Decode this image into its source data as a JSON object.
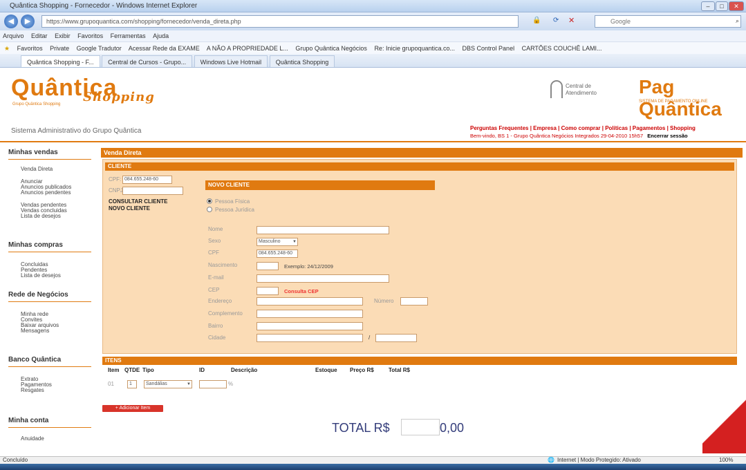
{
  "window": {
    "title": "Quântica Shopping - Fornecedor - Windows Internet Explorer"
  },
  "address": {
    "url": "https://www.grupoquantica.com/shopping/fornecedor/venda_direta.php",
    "search": "Google"
  },
  "menu": [
    "Arquivo",
    "Editar",
    "Exibir",
    "Favoritos",
    "Ferramentas",
    "Ajuda"
  ],
  "favorites": [
    "Favoritos",
    "Private",
    "Google Tradutor",
    "Acessar Rede da EXAME",
    "A NÃO A PROPRIEDADE L...",
    "Grupo Quântica Negócios",
    "Re: Inicie grupoquantica.co...",
    "DBS Control Panel",
    "CARTÕES COUCHÊ LAMI..."
  ],
  "tabs": [
    "Quântica Shopping - F...",
    "Central de Cursos - Grupo...",
    "Windows Live Hotmail",
    "Quântica Shopping"
  ],
  "header": {
    "logo": "Quântica",
    "logo_script": "Shopping",
    "logo_sub": "Grupo Quântica Shopping",
    "central_line1": "Central de",
    "central_line2": "Atendimento",
    "pag_logo": "Pag Quântica",
    "pag_sub": "SISTEMA DE PAGAMENTO ONLINE",
    "system_title": "Sistema Administrativo do Grupo Quântica",
    "top_links": "Perguntas Frequentes | Empresa | Como comprar | Políticas | Pagamentos | Shopping",
    "user_line": "Bem-vindo, BS 1 - Grupo Quântica Negócios Integrados 29-04-2010 15h57",
    "logout": "Encerrar sessão"
  },
  "sidebar": {
    "minhas_vendas": {
      "title": "Minhas vendas",
      "links": [
        "Venda Direta",
        "Anunciar",
        "Anuncios publicados",
        "Anuncios pendentes",
        "Vendas pendentes",
        "Vendas concluidas",
        "Lista de desejos"
      ]
    },
    "minhas_compras": {
      "title": "Minhas compras",
      "links": [
        "Concluidas",
        "Pendentes",
        "Lista de desejos"
      ]
    },
    "rede": {
      "title": "Rede de Negócios",
      "links": [
        "Minha rede",
        "Convites",
        "Baixar arquivos",
        "Mensagens"
      ]
    },
    "banco": {
      "title": "Banco Quântica",
      "links": [
        "Extrato",
        "Pagamentos",
        "Resgates"
      ]
    },
    "conta": {
      "title": "Minha conta",
      "links": [
        "Anuidade"
      ]
    }
  },
  "main": {
    "venda_direta": "Venda Direta",
    "cliente_header": "CLIENTE",
    "cpf_label": "CPF:",
    "cpf_value": "084.655.248-60",
    "cnpj_label": "CNPJ:",
    "consultar": "CONSULTAR CLIENTE",
    "novo_cliente": "NOVO CLIENTE",
    "novo_header": "NOVO CLIENTE",
    "pessoa_fisica": "Pessoa Física",
    "pessoa_juridica": "Pessoa Jurídica",
    "fields": {
      "nome": "Nome",
      "sexo": "Sexo",
      "sexo_value": "Masculino",
      "cpf": "CPF",
      "cpf_value": "084.655.248-60",
      "nascimento": "Nascimento",
      "nascimento_example": "Exemplo: 24/12/2009",
      "email": "E-mail",
      "cep": "CEP",
      "consulta_cep": "Consulta CEP",
      "endereco": "Endereço",
      "numero": "Número",
      "complemento": "Complemento",
      "bairro": "Bairro",
      "cidade": "Cidade",
      "slash": "/"
    },
    "itens_header": "ITENS",
    "itens_cols": [
      "Item",
      "QTDE",
      "Tipo",
      "ID",
      "Descrição",
      "Estoque",
      "Preço R$",
      "Total R$"
    ],
    "itens_row": {
      "item": "01",
      "qtde": "1",
      "tipo": "Sandálias",
      "pct": "%"
    },
    "add_item": "+ Adicionar Item",
    "total_label": "TOTAL R$",
    "total_value": "0,00"
  },
  "status": {
    "left": "Concluído",
    "zone": "Internet | Modo Protegido: Ativado",
    "zoom": "100%"
  }
}
